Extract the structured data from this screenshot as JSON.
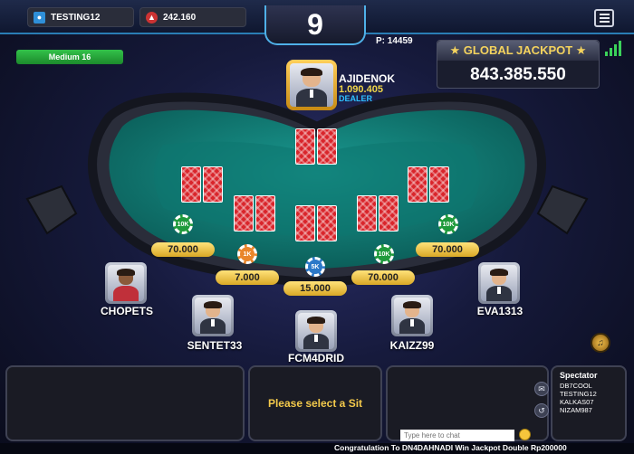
{
  "topbar": {
    "username": "TESTING12",
    "chips": "242.160",
    "room_number": "9"
  },
  "players_count": "P: 14459",
  "level_badge": "Medium 16",
  "jackpot": {
    "title": "★ GLOBAL JACKPOT ★",
    "value": "843.385.550"
  },
  "dealer": {
    "name": "AJIDENOK",
    "chips": "1.090.405",
    "label": "DEALER"
  },
  "bets": [
    "70.000",
    "7.000",
    "15.000",
    "70.000",
    "70.000"
  ],
  "chips": {
    "c1": "10K",
    "c2": "1K",
    "c3": "5K",
    "c4": "10K",
    "c5": "10K"
  },
  "seats": [
    "CHOPETS",
    "SENTET33",
    "FCM4DRID",
    "KAIZZ99",
    "EVA1313"
  ],
  "bottom": {
    "select_seat": "Please select a Sit",
    "chat_placeholder": "Type here to chat",
    "spectator_title": "Spectator",
    "spectators": [
      "DB7COOL",
      "TESTING12",
      "KALKAS07",
      "NIZAM987"
    ]
  },
  "ticker": "Congratulation To DN4DAHNADI Win Jackpot Double Rp200000",
  "colors": {
    "felt": "#0f7a73",
    "rail": "#1a1d28",
    "accent_blue": "#4fb0e8",
    "gold": "#f3c94b",
    "card_red": "#d9252b"
  }
}
